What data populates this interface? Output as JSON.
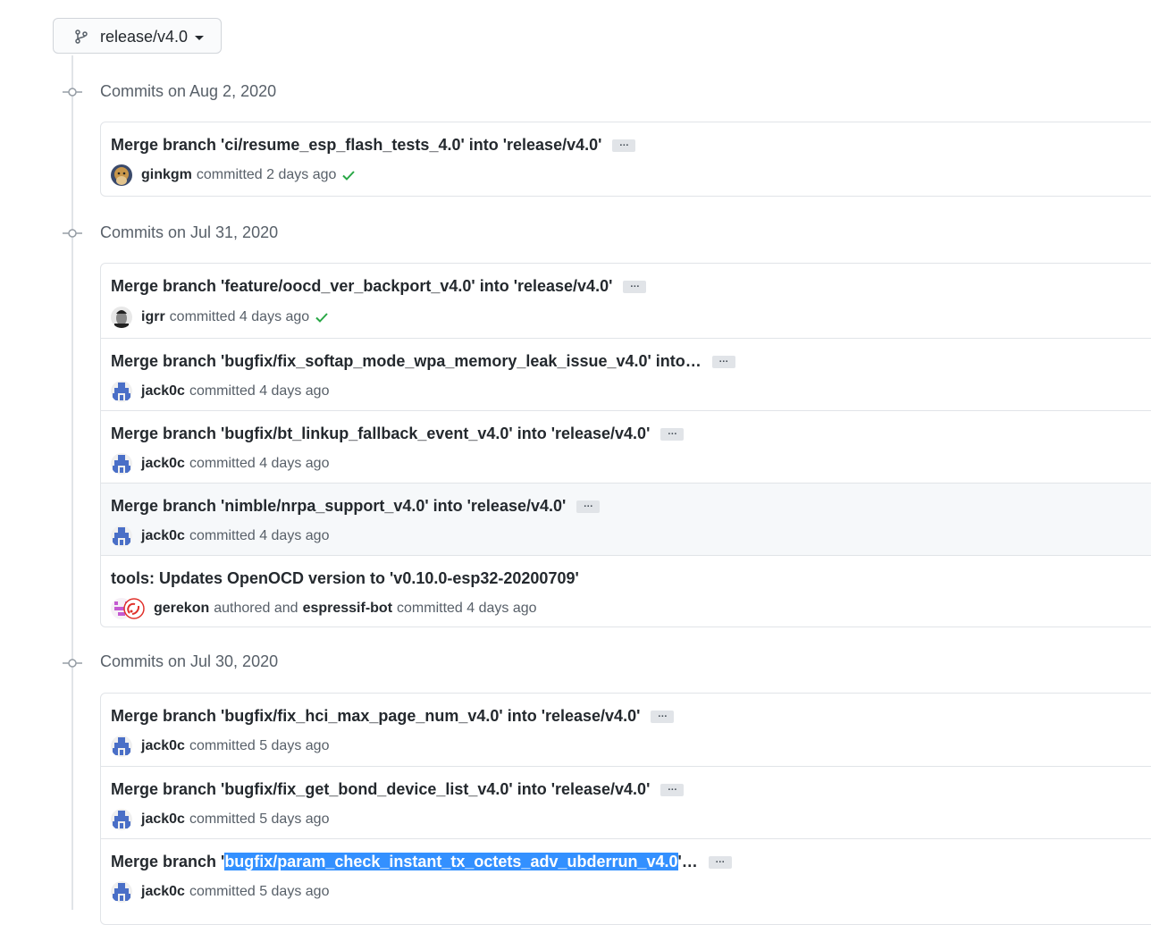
{
  "branch": {
    "name": "release/v4.0",
    "icon": "git-branch-icon"
  },
  "colors": {
    "check": "#28a745",
    "selection": "#3390ff",
    "muted": "#586069"
  },
  "groups": [
    {
      "title": "Commits on Aug 2, 2020",
      "commits": [
        {
          "msg": "Merge branch 'ci/resume_esp_flash_tests_4.0' into 'release/v4.0'",
          "author": "ginkgm",
          "action": "committed",
          "time": "2 days ago",
          "check": true
        }
      ]
    },
    {
      "title": "Commits on Jul 31, 2020",
      "commits": [
        {
          "msg": "Merge branch 'feature/oocd_ver_backport_v4.0' into 'release/v4.0'",
          "author": "igrr",
          "action": "committed",
          "time": "4 days ago",
          "check": true
        },
        {
          "msg": "Merge branch 'bugfix/fix_softap_mode_wpa_memory_leak_issue_v4.0' into…",
          "author": "jack0c",
          "action": "committed",
          "time": "4 days ago"
        },
        {
          "msg": "Merge branch 'bugfix/bt_linkup_fallback_event_v4.0' into 'release/v4.0'",
          "author": "jack0c",
          "action": "committed",
          "time": "4 days ago"
        },
        {
          "msg": "Merge branch 'nimble/nrpa_support_v4.0' into 'release/v4.0'",
          "author": "jack0c",
          "action": "committed",
          "time": "4 days ago"
        },
        {
          "msg": "tools: Updates OpenOCD version to 'v0.10.0-esp32-20200709'",
          "author": "gerekon",
          "action": "authored and",
          "author2": "espressif-bot",
          "action2": "committed",
          "time": "4 days ago"
        }
      ]
    },
    {
      "title": "Commits on Jul 30, 2020",
      "commits": [
        {
          "msg": "Merge branch 'bugfix/fix_hci_max_page_num_v4.0' into 'release/v4.0'",
          "author": "jack0c",
          "action": "committed",
          "time": "5 days ago"
        },
        {
          "msg": "Merge branch 'bugfix/fix_get_bond_device_list_v4.0' into 'release/v4.0'",
          "author": "jack0c",
          "action": "committed",
          "time": "5 days ago"
        },
        {
          "msg_pre": "Merge branch '",
          "msg_sel": "bugfix/param_check_instant_tx_octets_adv_ubderrun_v4.0",
          "msg_post": "'…",
          "author": "jack0c",
          "action": "committed",
          "time": "5 days ago"
        }
      ]
    }
  ],
  "ellipsis": "…"
}
